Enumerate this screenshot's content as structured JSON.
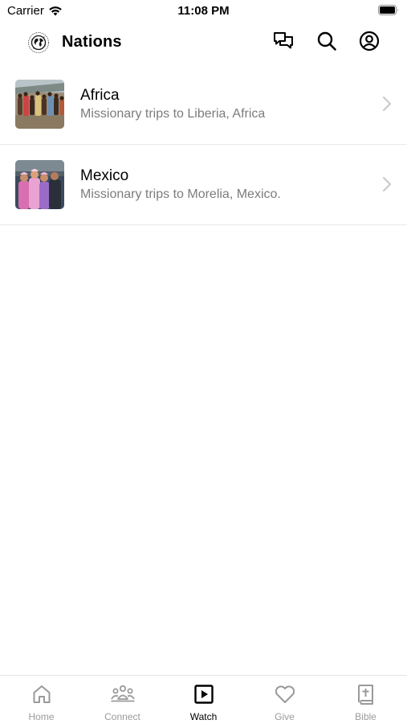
{
  "status_bar": {
    "carrier": "Carrier",
    "time": "11:08 PM"
  },
  "header": {
    "title": "Nations",
    "logo_icon": "globe-logo-icon",
    "actions": [
      "chat-icon",
      "search-icon",
      "profile-icon"
    ]
  },
  "list": {
    "items": [
      {
        "title": "Africa",
        "subtitle": "Missionary trips to Liberia, Africa",
        "thumbnail": "africa-group-photo"
      },
      {
        "title": "Mexico",
        "subtitle": "Missionary trips to Morelia, Mexico.",
        "thumbnail": "mexico-children-photo"
      }
    ]
  },
  "tab_bar": {
    "active": "Watch",
    "tabs": [
      {
        "label": "Home",
        "icon": "home-icon"
      },
      {
        "label": "Connect",
        "icon": "people-icon"
      },
      {
        "label": "Watch",
        "icon": "play-icon"
      },
      {
        "label": "Give",
        "icon": "heart-icon"
      },
      {
        "label": "Bible",
        "icon": "bible-icon"
      }
    ]
  },
  "colors": {
    "active_tab": "#000000",
    "inactive_tab": "#9a9a9a",
    "subtitle": "#7c7c7c",
    "divider": "#e8e8e8"
  }
}
